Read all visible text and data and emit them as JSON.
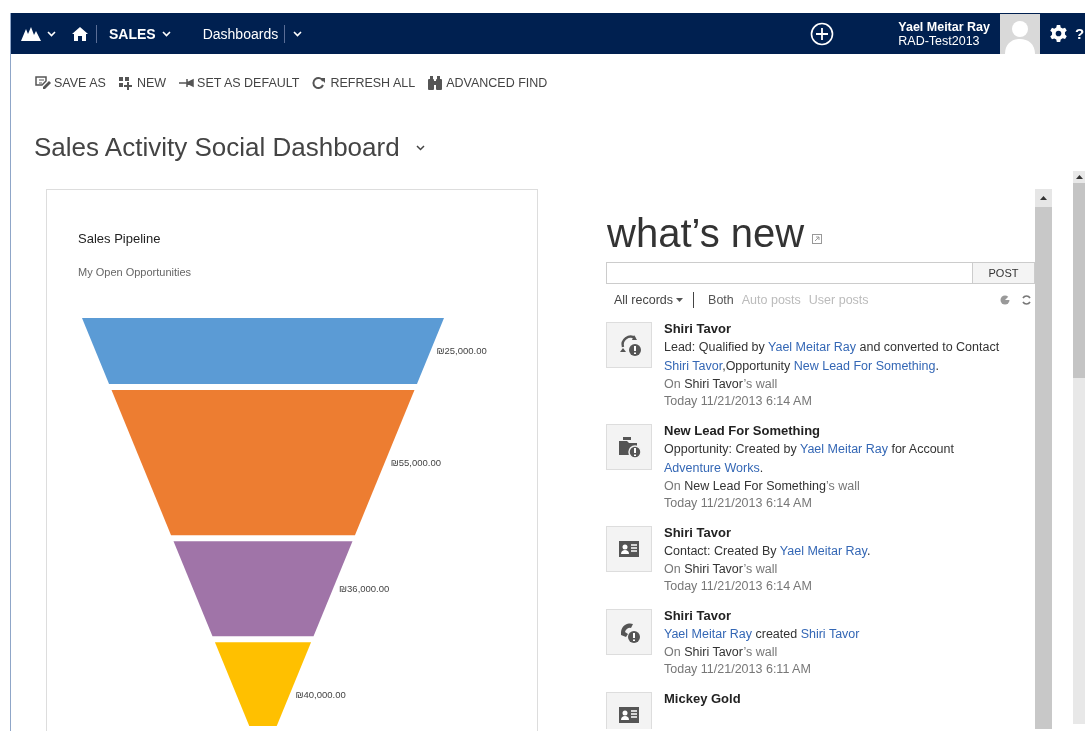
{
  "nav": {
    "module": "SALES",
    "area": "Dashboards",
    "user_name": "Yael Meitar Ray",
    "org": "RAD-Test2013",
    "help": "?"
  },
  "toolbar": [
    {
      "label": "SAVE AS",
      "kind": "save"
    },
    {
      "label": "NEW",
      "kind": "new"
    },
    {
      "label": "SET AS DEFAULT",
      "kind": "pin"
    },
    {
      "label": "REFRESH ALL",
      "kind": "refresh"
    },
    {
      "label": "ADVANCED FIND",
      "kind": "find"
    }
  ],
  "dashboard": {
    "title": "Sales Activity Social Dashboard"
  },
  "chart": {
    "title": "Sales Pipeline",
    "subtitle": "My Open Opportunities",
    "segments": [
      {
        "label": "₪25,000.00",
        "color": "#5b9bd5"
      },
      {
        "label": "₪55,000.00",
        "color": "#ed7d31"
      },
      {
        "label": "₪36,000.00",
        "color": "#a074a8"
      },
      {
        "label": "₪40,000.00",
        "color": "#ffc000"
      }
    ]
  },
  "feed": {
    "title": "what’s new",
    "post_button": "POST",
    "records_filter": "All records",
    "tabs": [
      {
        "label": "Both",
        "selected": true
      },
      {
        "label": "Auto posts",
        "selected": false
      },
      {
        "label": "User posts",
        "selected": false
      }
    ],
    "posts": [
      {
        "kind": "lead",
        "title": "Shiri Tavor",
        "body": [
          {
            "text": "Lead: Qualified by "
          },
          {
            "text": "Yael Meitar Ray",
            "link": true
          },
          {
            "text": " and converted to Contact "
          },
          {
            "text": "Shiri Tavor",
            "link": true
          },
          {
            "text": ","
          },
          {
            "text": "Opportunity "
          },
          {
            "text": "New Lead For Something",
            "link": true
          },
          {
            "text": "."
          }
        ],
        "wall": [
          {
            "text": "On "
          },
          {
            "text": "Shiri Tavor",
            "strong": true
          },
          {
            "text": "’s wall"
          }
        ],
        "time": "Today 11/21/2013 6:14 AM"
      },
      {
        "kind": "opportunity",
        "title": "New Lead For Something",
        "body": [
          {
            "text": "Opportunity: Created by "
          },
          {
            "text": "Yael Meitar Ray",
            "link": true
          },
          {
            "text": " for Account "
          },
          {
            "text": "Adventure Works",
            "link": true
          },
          {
            "text": "."
          }
        ],
        "wall": [
          {
            "text": "On "
          },
          {
            "text": "New Lead For Something",
            "strong": true
          },
          {
            "text": "’s wall"
          }
        ],
        "time": "Today 11/21/2013 6:14 AM"
      },
      {
        "kind": "contact",
        "title": "Shiri Tavor",
        "body": [
          {
            "text": "Contact: Created By "
          },
          {
            "text": "Yael Meitar Ray",
            "link": true
          },
          {
            "text": "."
          }
        ],
        "wall": [
          {
            "text": "On "
          },
          {
            "text": "Shiri Tavor",
            "strong": true
          },
          {
            "text": "’s wall"
          }
        ],
        "time": "Today 11/21/2013 6:14 AM"
      },
      {
        "kind": "phone",
        "title": "Shiri Tavor",
        "body": [
          {
            "text": "Yael Meitar Ray",
            "link": true
          },
          {
            "text": " created "
          },
          {
            "text": "Shiri Tavor",
            "link": true
          }
        ],
        "wall": [
          {
            "text": "On "
          },
          {
            "text": "Shiri Tavor",
            "strong": true
          },
          {
            "text": "’s wall"
          }
        ],
        "time": "Today 11/21/2013 6:11 AM"
      },
      {
        "kind": "contact",
        "title": "Mickey Gold"
      }
    ]
  }
}
